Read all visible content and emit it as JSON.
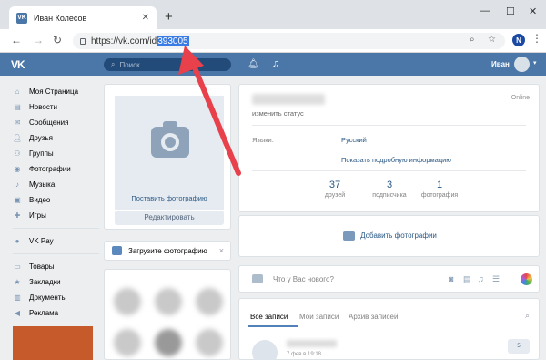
{
  "browser": {
    "tab_title": "Иван Колесов",
    "url_prefix": "https://vk.com/id",
    "url_selected": "393005",
    "profile_initial": "N"
  },
  "header": {
    "logo": "VK",
    "search_placeholder": "Поиск",
    "user_name": "Иван"
  },
  "sidebar": {
    "items": [
      {
        "label": "Моя Страница",
        "icon": "home-icon"
      },
      {
        "label": "Новости",
        "icon": "news-icon"
      },
      {
        "label": "Сообщения",
        "icon": "messages-icon"
      },
      {
        "label": "Друзья",
        "icon": "friends-icon"
      },
      {
        "label": "Группы",
        "icon": "groups-icon"
      },
      {
        "label": "Фотографии",
        "icon": "photos-icon"
      },
      {
        "label": "Музыка",
        "icon": "music-icon"
      },
      {
        "label": "Видео",
        "icon": "video-icon"
      },
      {
        "label": "Игры",
        "icon": "games-icon"
      }
    ],
    "vkpay": {
      "label": "VK Pay",
      "icon": "vkpay-icon"
    },
    "extra": [
      {
        "label": "Товары",
        "icon": "goods-icon"
      },
      {
        "label": "Закладки",
        "icon": "bookmarks-icon"
      },
      {
        "label": "Документы",
        "icon": "documents-icon"
      },
      {
        "label": "Реклама",
        "icon": "ads-icon"
      }
    ]
  },
  "avatar_card": {
    "set_photo": "Поставить фотографию",
    "edit": "Редактировать"
  },
  "upload_card": {
    "label": "Загрузите фотографию",
    "close": "×"
  },
  "profile": {
    "status": "изменить статус",
    "online": "Online",
    "languages_label": "Языки:",
    "languages_value": "Русский",
    "more_info": "Показать подробную информацию",
    "counters": [
      {
        "value": "37",
        "label": "друзей"
      },
      {
        "value": "3",
        "label": "подписчика"
      },
      {
        "value": "1",
        "label": "фотография"
      }
    ]
  },
  "add_photo": {
    "label": "Добавить фотографии"
  },
  "post_box": {
    "placeholder": "Что у Вас нового?"
  },
  "wall": {
    "tabs": [
      "Все записи",
      "Мои записи",
      "Архив записей"
    ],
    "date": "7 фев в 19:18",
    "badge": "5"
  },
  "colors": {
    "vk_blue": "#4a76a8",
    "link": "#2a5885",
    "page_bg": "#edeef0",
    "arrow": "#e8414b",
    "url_selection": "#3a7ce6"
  }
}
